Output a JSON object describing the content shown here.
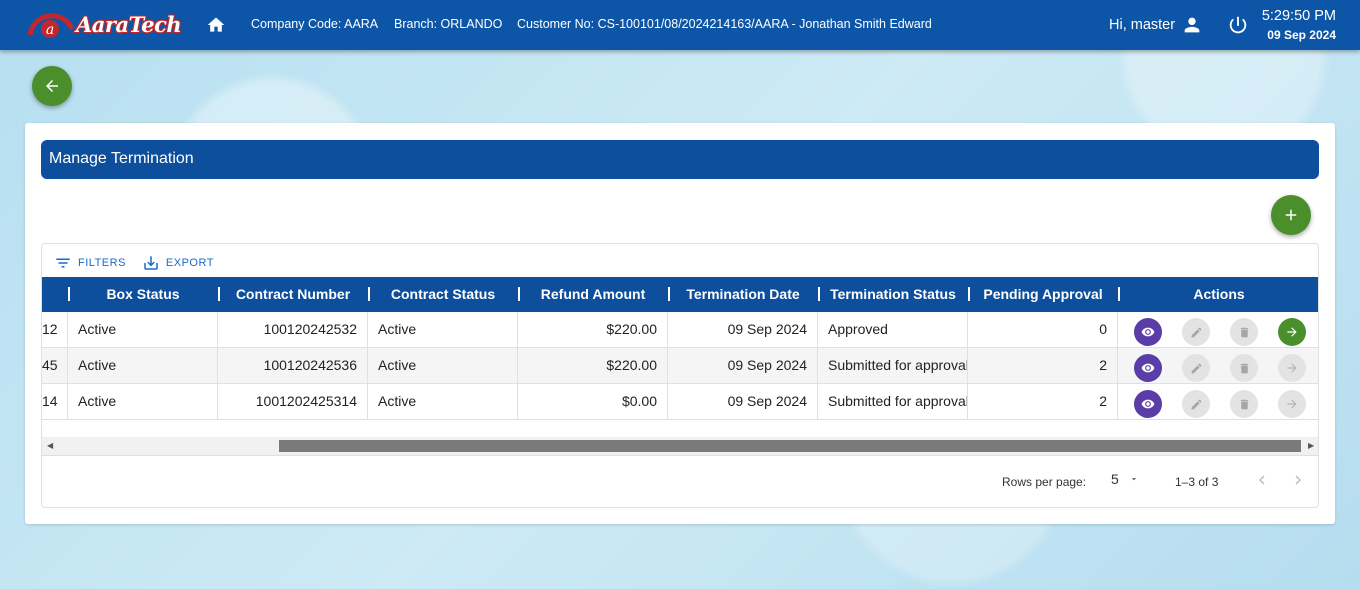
{
  "header": {
    "logo_text": "AaraTech",
    "company_code": "Company Code: AARA",
    "branch": "Branch: ORLANDO",
    "customer": "Customer No: CS-100101/08/2024214163/AARA - Jonathan Smith Edward",
    "greeting": "Hi, master",
    "time": "5:29:50 PM",
    "date": "09 Sep 2024",
    "icons": [
      "home-icon",
      "user-icon",
      "power-icon"
    ]
  },
  "page": {
    "title": "Manage Termination"
  },
  "toolbar": {
    "filters_label": "FILTERS",
    "export_label": "EXPORT"
  },
  "table": {
    "columns": [
      "",
      "Box Status",
      "Contract Number",
      "Contract Status",
      "Refund Amount",
      "Termination Date",
      "Termination Status",
      "Pending Approval",
      "Actions"
    ],
    "rows": [
      {
        "id_tail": "12",
        "box_status": "Active",
        "contract_number": "100120242532",
        "contract_status": "Active",
        "refund_amount": "$220.00",
        "termination_date": "09 Sep 2024",
        "termination_status": "Approved",
        "pending_approval": "0",
        "forward_enabled": true
      },
      {
        "id_tail": "45",
        "box_status": "Active",
        "contract_number": "100120242536",
        "contract_status": "Active",
        "refund_amount": "$220.00",
        "termination_date": "09 Sep 2024",
        "termination_status": "Submitted for approval",
        "pending_approval": "2",
        "forward_enabled": false
      },
      {
        "id_tail": "14",
        "box_status": "Active",
        "contract_number": "1001202425314",
        "contract_status": "Active",
        "refund_amount": "$0.00",
        "termination_date": "09 Sep 2024",
        "termination_status": "Submitted for approval",
        "pending_approval": "2",
        "forward_enabled": false
      }
    ]
  },
  "pagination": {
    "rows_per_page_label": "Rows per page:",
    "rows_per_page": "5",
    "range": "1–3 of 3"
  },
  "colors": {
    "header_blue": "#0d55a6",
    "title_blue": "#0d4f9c",
    "green": "#4a8f2c",
    "purple": "#5b3da8"
  }
}
